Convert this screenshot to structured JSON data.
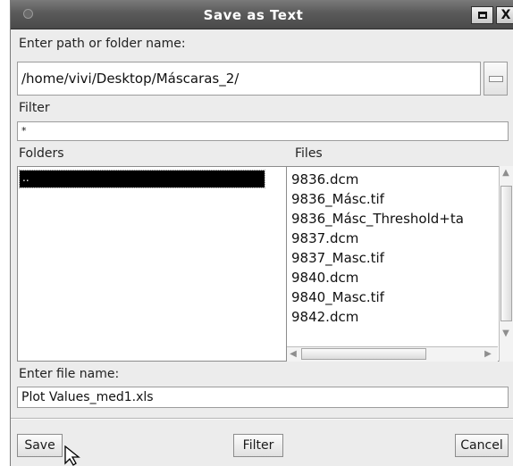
{
  "window": {
    "title": "Save as Text",
    "maximize_icon": "maximize-icon",
    "close_label": "X"
  },
  "path": {
    "label": "Enter path or folder name:",
    "value": "/home/vivi/Desktop/Máscaras_2/"
  },
  "filter": {
    "label": "Filter",
    "value": "*"
  },
  "folders": {
    "label": "Folders",
    "items": [
      ".."
    ]
  },
  "files": {
    "label": "Files",
    "items": [
      "9836.dcm",
      "9836_Másc.tif",
      "9836_Másc_Threshold+ta",
      "9837.dcm",
      "9837_Masc.tif",
      "9840.dcm",
      "9840_Masc.tif",
      "9842.dcm"
    ]
  },
  "filename": {
    "label": "Enter file name:",
    "value": "Plot Values_med1.xls"
  },
  "buttons": {
    "save": "Save",
    "filter": "Filter",
    "cancel": "Cancel"
  }
}
